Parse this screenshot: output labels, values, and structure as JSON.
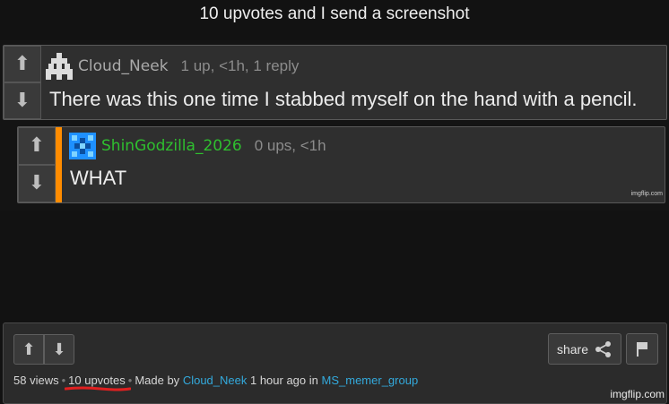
{
  "page": {
    "title": "10 upvotes and I send a screenshot"
  },
  "meme": {
    "comments": [
      {
        "username": "Cloud_Neek",
        "meta": "1 up, <1h, 1 reply",
        "text": "There was this one time I stabbed myself on the hand with a pencil.",
        "avatar_icon": "pixel-invader-icon"
      },
      {
        "username": "ShinGodzilla_2026",
        "meta": "0 ups, <1h",
        "text": "WHAT",
        "avatar_icon": "pixel-checker-icon"
      }
    ],
    "watermark": "imgflip.com"
  },
  "footer": {
    "share_label": "share",
    "views": "58 views",
    "upvotes": "10 upvotes",
    "made_by_label": "Made by",
    "author": "Cloud_Neek",
    "time": "1 hour ago in",
    "stream": "MS_memer_group",
    "watermark": "imgflip.com"
  },
  "colors": {
    "green_username": "#2fbf2f",
    "orange_bar": "#ff8c00",
    "link": "#33aadd",
    "underline": "#e02020"
  }
}
